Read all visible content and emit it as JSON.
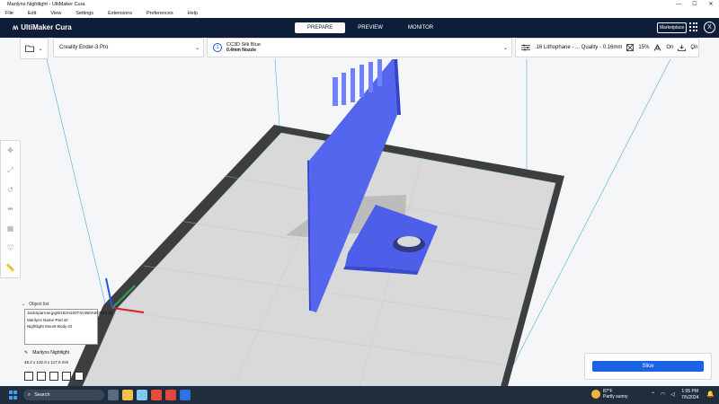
{
  "window": {
    "title": "Marilyns Nightlight - UltiMaker Cura",
    "controls": [
      "—",
      "☐",
      "✕"
    ]
  },
  "menu": [
    "File",
    "Edit",
    "View",
    "Settings",
    "Extensions",
    "Preferences",
    "Help"
  ],
  "header": {
    "logo": "UltiMaker Cura",
    "tabs": [
      {
        "label": "PREPARE",
        "active": true
      },
      {
        "label": "PREVIEW",
        "active": false
      },
      {
        "label": "MONITOR",
        "active": false
      }
    ],
    "marketplace": "Marketplace",
    "account_initial": "X"
  },
  "toolbar": {
    "printer": "Creality Ender-3 Pro",
    "material_index": "1",
    "material": "CC3D Silk Blue",
    "nozzle": "0.4mm Nozzle",
    "profile": ".16 Lithophane - ... Quality - 0.16mm",
    "infill": "15%",
    "support": "On",
    "adhesion": "On"
  },
  "object_list": {
    "header": "Object list",
    "items": [
      "JackSparrow.jpgW152H100T3V4B0A0C0NS.stl",
      "Marilyns Name-Part.stl",
      "Nightlight Mount-Body.stl"
    ],
    "project_name": "Marilyns Nightlight",
    "dimensions": "48.2 x 132.0 x 117.0 mm"
  },
  "slice": {
    "button": "Slice"
  },
  "taskbar": {
    "search": "Search",
    "weather_temp": "87°F",
    "weather_desc": "Partly sunny",
    "time": "1:05 PM",
    "date": "7/5/2024"
  },
  "colors": {
    "header": "#0e1d3a",
    "accent": "#1a62e6",
    "model": "#5566ee",
    "taskbar": "#1f2d3d"
  }
}
